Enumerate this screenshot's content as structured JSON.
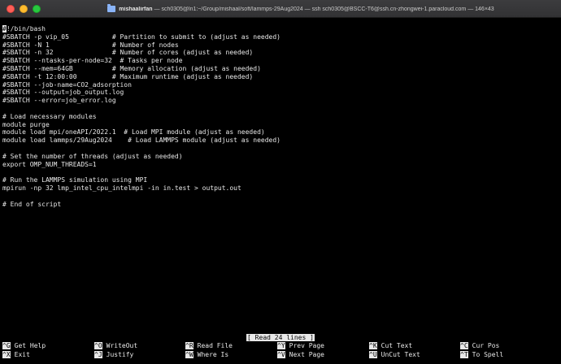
{
  "window": {
    "title_user": "mishaalirfan",
    "title_rest": "— sch0305@ln1:~/Group/mishaal/soft/lammps-29Aug2024 — ssh sch0305@BSCC-T6@ssh.cn-zhongwei-1.paracloud.com — 146×43"
  },
  "editor": {
    "cursor_char": "#",
    "lines": [
      "!/bin/bash",
      "#SBATCH -p vip_05           # Partition to submit to (adjust as needed)",
      "#SBATCH -N 1                # Number of nodes",
      "#SBATCH -n 32               # Number of cores (adjust as needed)",
      "#SBATCH --ntasks-per-node=32  # Tasks per node",
      "#SBATCH --mem=64GB          # Memory allocation (adjust as needed)",
      "#SBATCH -t 12:00:00         # Maximum runtime (adjust as needed)",
      "#SBATCH --job-name=CO2_adsorption",
      "#SBATCH --output=job_output.log",
      "#SBATCH --error=job_error.log",
      "",
      "# Load necessary modules",
      "module purge",
      "module load mpi/oneAPI/2022.1  # Load MPI module (adjust as needed)",
      "module load lammps/29Aug2024    # Load LAMMPS module (adjust as needed)",
      "",
      "# Set the number of threads (adjust as needed)",
      "export OMP_NUM_THREADS=1",
      "",
      "# Run the LAMMPS simulation using MPI",
      "mpirun -np 32 lmp_intel_cpu_intelmpi -in in.test > output.out",
      "",
      "# End of script"
    ],
    "status": "[ Read 24 lines ]"
  },
  "shortcuts": [
    {
      "key": "^G",
      "label": "Get Help"
    },
    {
      "key": "^O",
      "label": "WriteOut"
    },
    {
      "key": "^R",
      "label": "Read File"
    },
    {
      "key": "^Y",
      "label": "Prev Page"
    },
    {
      "key": "^K",
      "label": "Cut Text"
    },
    {
      "key": "^C",
      "label": "Cur Pos"
    },
    {
      "key": "^X",
      "label": "Exit"
    },
    {
      "key": "^J",
      "label": "Justify"
    },
    {
      "key": "^W",
      "label": "Where Is"
    },
    {
      "key": "^V",
      "label": "Next Page"
    },
    {
      "key": "^U",
      "label": "UnCut Text"
    },
    {
      "key": "^T",
      "label": "To Spell"
    }
  ]
}
